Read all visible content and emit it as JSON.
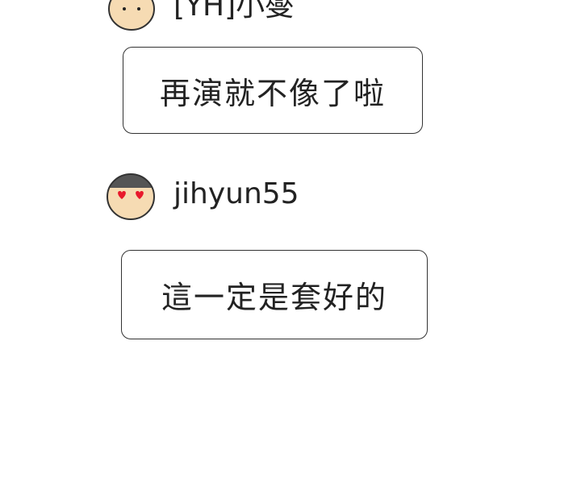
{
  "messages": [
    {
      "username": "[YH]小燮",
      "avatar": "smiling-face-avatar-icon",
      "text": "再演就不像了啦"
    },
    {
      "username": "jihyun55",
      "avatar": "heart-eyes-avatar-icon",
      "text": "這一定是套好的"
    }
  ],
  "colors": {
    "skin": "#f6dbb3",
    "hair": "#555555",
    "outline": "#333333",
    "heart": "#e8192c",
    "background": "#ffffff"
  }
}
